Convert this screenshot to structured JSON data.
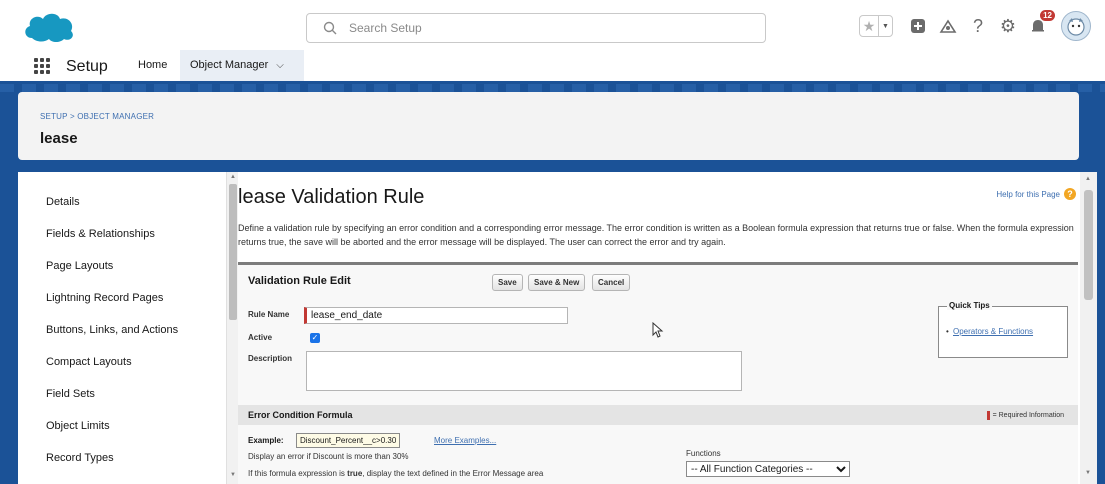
{
  "colors": {
    "brand": "#1b5297",
    "link": "#3e6fb0",
    "required": "#c23934",
    "cloud": "#1798c1",
    "badge": "#c23934"
  },
  "header": {
    "logo_icon": "salesforce-cloud-icon",
    "search_placeholder": "Search Setup",
    "icons": [
      "star-icon",
      "chevron-down-icon",
      "plus-icon",
      "trailhead-icon",
      "help-icon",
      "gear-icon",
      "bell-icon",
      "avatar"
    ],
    "notification_count": "12"
  },
  "nav": {
    "app_name": "Setup",
    "tabs": [
      {
        "label": "Home"
      },
      {
        "label": "Object Manager",
        "active": true
      }
    ]
  },
  "page_header": {
    "breadcrumb": "SETUP > OBJECT MANAGER",
    "title": "lease"
  },
  "sidebar": {
    "items": [
      {
        "label": "Details"
      },
      {
        "label": "Fields & Relationships"
      },
      {
        "label": "Page Layouts"
      },
      {
        "label": "Lightning Record Pages"
      },
      {
        "label": "Buttons, Links, and Actions"
      },
      {
        "label": "Compact Layouts"
      },
      {
        "label": "Field Sets"
      },
      {
        "label": "Object Limits"
      },
      {
        "label": "Record Types"
      }
    ]
  },
  "content": {
    "title": "lease Validation Rule",
    "help_link": "Help for this Page",
    "description": "Define a validation rule by specifying an error condition and a corresponding error message. The error condition is written as a Boolean formula expression that returns true or false. When the formula expression returns true, the save will be aborted and the error message will be displayed. The user can correct the error and try again.",
    "panel_title": "Validation Rule Edit",
    "buttons": {
      "save": "Save",
      "save_new": "Save & New",
      "cancel": "Cancel"
    },
    "fields": {
      "rule_name_label": "Rule Name",
      "rule_name_value": "lease_end_date",
      "active_label": "Active",
      "active_checked": true,
      "description_label": "Description",
      "description_value": ""
    },
    "quick_tips": {
      "title": "Quick Tips",
      "link": "Operators & Functions"
    },
    "error_section": {
      "title": "Error Condition Formula",
      "required_info": "= Required Information",
      "example_label": "Example:",
      "example_value": "Discount_Percent__c>0.30",
      "more_examples": "More Examples...",
      "example_note": "Display an error if Discount is more than 30%",
      "formula_note_prefix": "If this formula expression is ",
      "formula_note_bold": "true",
      "formula_note_suffix": ", display the text defined in the Error Message area",
      "functions_label": "Functions",
      "functions_selected": "-- All Function Categories --"
    }
  }
}
